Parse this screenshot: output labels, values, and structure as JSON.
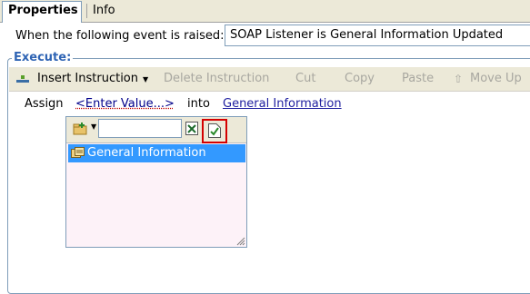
{
  "tabs": {
    "properties": "Properties",
    "info": "Info"
  },
  "event": {
    "label": "When the following event is raised:",
    "value": "SOAP Listener is General Information Updated"
  },
  "execute": {
    "legend": "Execute:"
  },
  "toolbar": {
    "insert": "Insert Instruction",
    "delete": "Delete Instruction",
    "cut": "Cut",
    "copy": "Copy",
    "paste": "Paste",
    "move_up": "Move Up"
  },
  "assign": {
    "label": "Assign",
    "value_link": "<Enter Value...>",
    "into": "into",
    "target_link": "General Information"
  },
  "popup": {
    "search_value": "",
    "items": [
      {
        "label": "General Information",
        "selected": true
      }
    ]
  },
  "colors": {
    "accent": "#2f64b4",
    "selection": "#3399ff",
    "highlight_border": "#d40000"
  },
  "icons": {
    "insert": "insert-instruction-icon",
    "move_up": "move-up-icon",
    "add": "add-item-icon",
    "clear": "excel-clear-icon",
    "confirm": "confirm-check-icon",
    "item": "database-icon"
  }
}
